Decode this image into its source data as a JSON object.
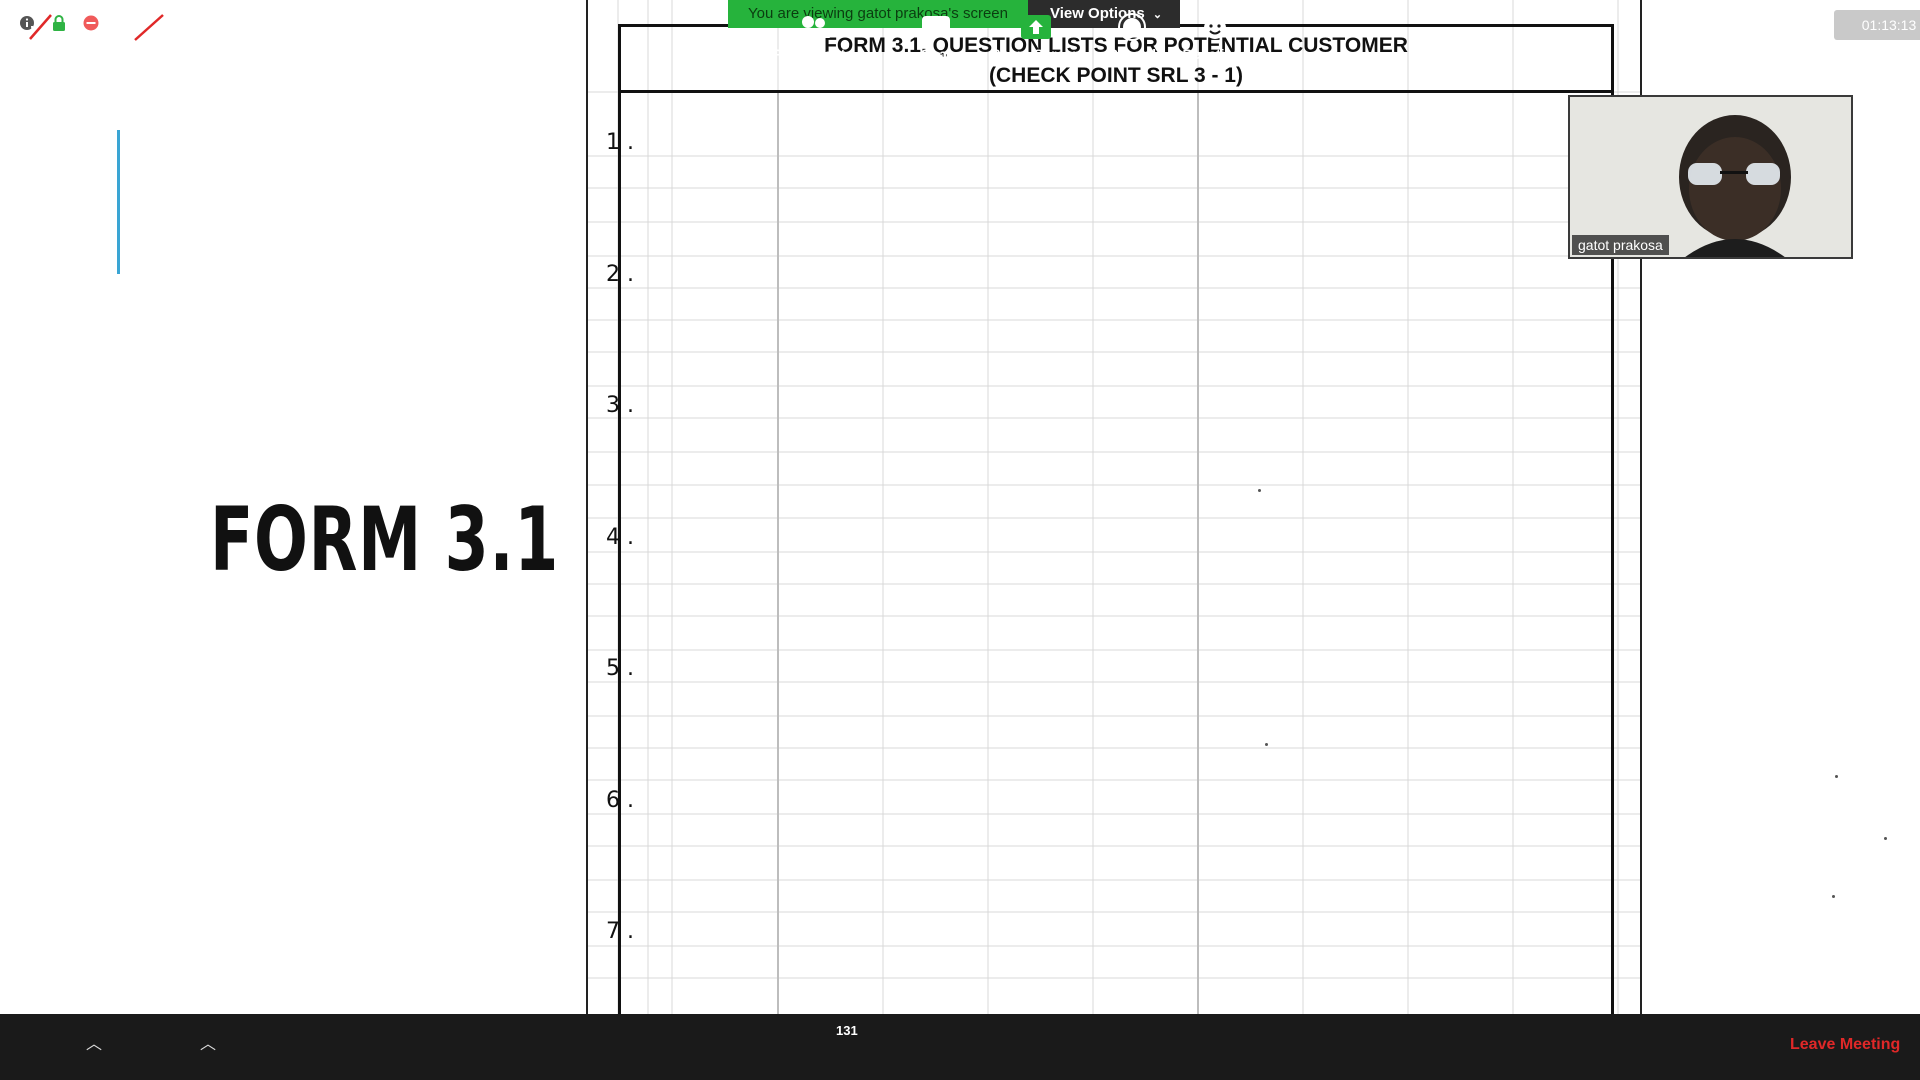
{
  "meeting": {
    "banner_text": "You are viewing gatot prakosa's screen",
    "view_options": "View Options",
    "timer": "01:13:13",
    "presenter_name": "gatot prakosa"
  },
  "slide": {
    "title": "FORM 3.1",
    "accent_color": "#3aa5d4"
  },
  "form": {
    "title_line1": "FORM 3.1. QUESTION LISTS FOR POTENTIAL CUSTOMER",
    "title_line2": "(CHECK POINT SRL 3 - 1)",
    "question_numbers": [
      "1 .",
      "2 .",
      "3 .",
      "4 .",
      "5 .",
      "6 .",
      "7 ."
    ]
  },
  "toolbar": {
    "unmute": "Unmute",
    "start_video": "Start Video",
    "participants": "Participants",
    "participant_count": "131",
    "chat": "Chat",
    "share_screen": "Share Screen",
    "record": "Record",
    "reactions": "Reactions",
    "leave": "Leave Meeting",
    "share_color": "#26b33c",
    "leave_color": "#e02828"
  }
}
